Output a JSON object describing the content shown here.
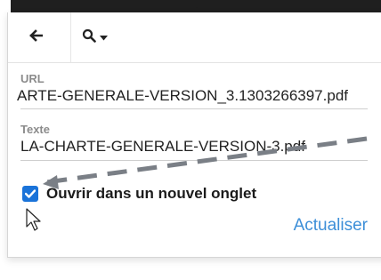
{
  "toolbar": {
    "back_icon": "arrow-left-icon",
    "search_icon": "search-icon",
    "dropdown_icon": "caret-down-icon"
  },
  "form": {
    "url_label": "URL",
    "url_value": "ARTE-GENERALE-VERSION_3.1303266397.pdf",
    "text_label": "Texte",
    "text_value": "LA-CHARTE-GENERALE-VERSION-3.pdf",
    "checkbox_checked": true,
    "checkbox_label": "Ouvrir dans un nouvel onglet",
    "update_label": "Actualiser"
  },
  "colors": {
    "accent": "#1a73d9",
    "link": "#3d8fd8",
    "annotation_arrow": "#7a7f86"
  },
  "cursor_icon": "mouse-pointer-icon"
}
